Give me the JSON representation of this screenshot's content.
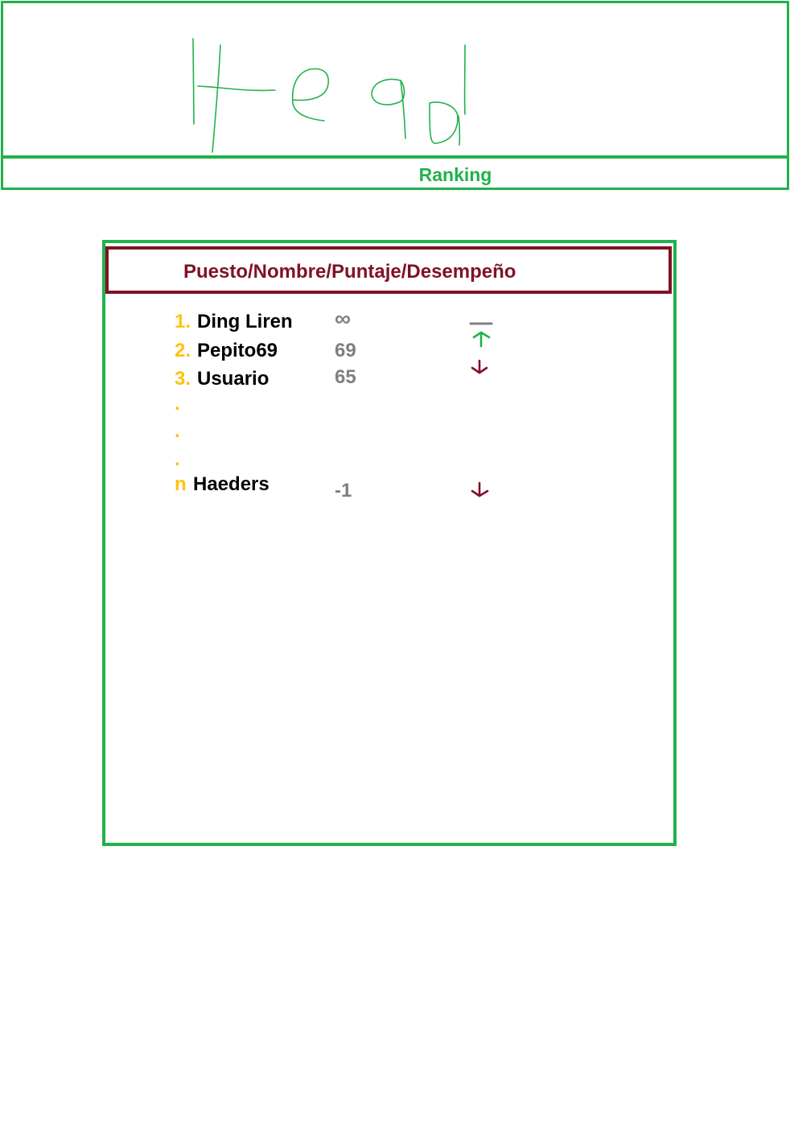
{
  "header": {
    "title_handwritten": "Head",
    "accent_color": "#22b14c"
  },
  "ranking_bar": {
    "label": "Ranking"
  },
  "panel": {
    "columns_label": "Puesto/Nombre/Puntaje/Desempeño",
    "header_color": "#7f1224",
    "rows": [
      {
        "rank": "1.",
        "name": "Ding Liren",
        "score": "∞",
        "performance": "same-icon"
      },
      {
        "rank": "2.",
        "name": "Pepito69",
        "score": "69",
        "performance": "up-arrow-icon"
      },
      {
        "rank": "3.",
        "name": "Usuario",
        "score": "65",
        "performance": "down-arrow-icon"
      },
      {
        "rank": "n",
        "name": "Haeders",
        "score": "-1",
        "performance": "down-arrow-icon"
      }
    ],
    "ellipsis_dots": [
      ".",
      ".",
      "."
    ],
    "rank_color": "#ffc20e",
    "score_color": "#7f7f7f",
    "up_color": "#22b14c",
    "down_color": "#7f1224",
    "same_color": "#7f7f7f"
  }
}
